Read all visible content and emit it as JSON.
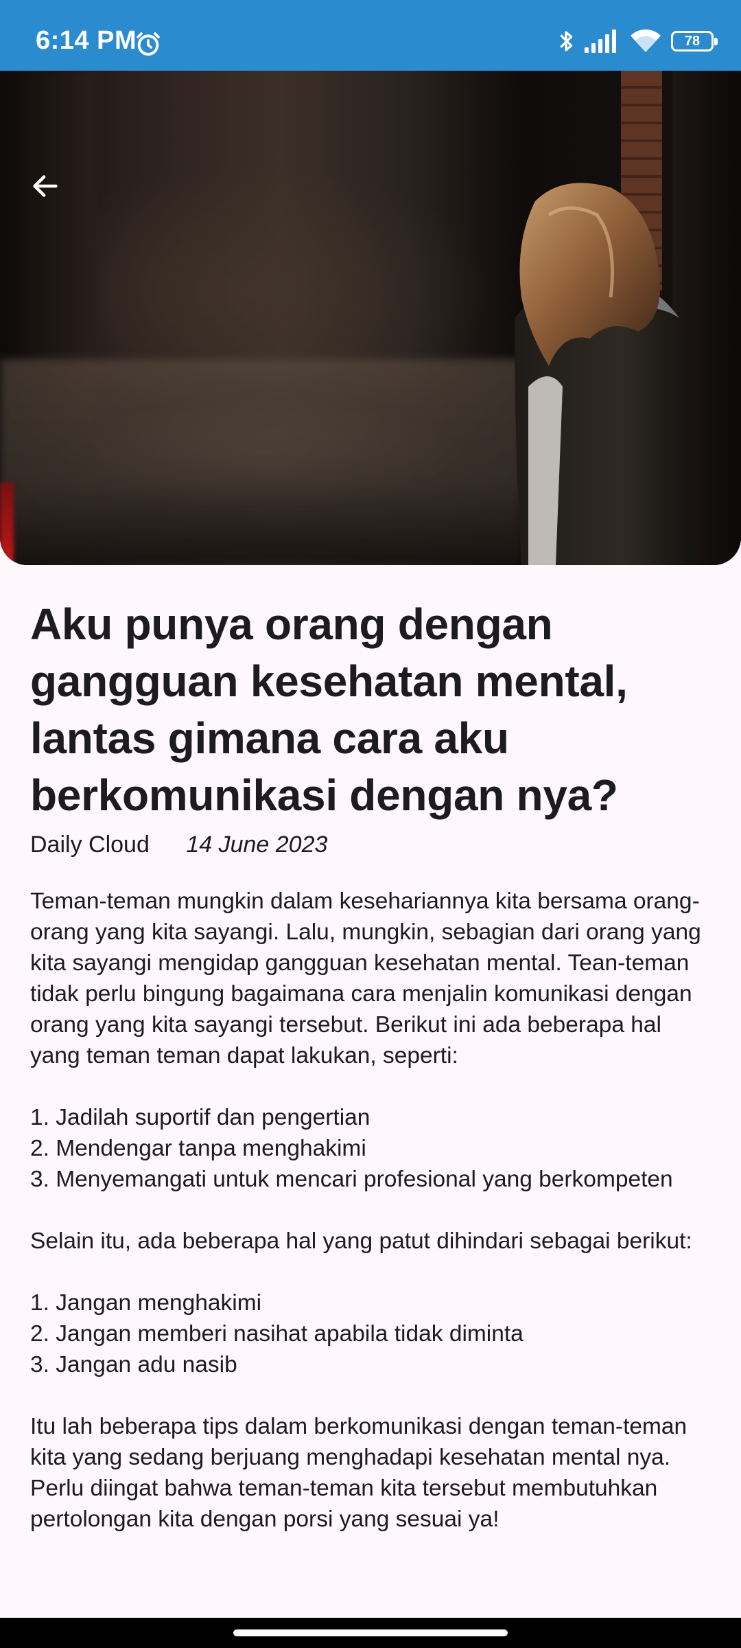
{
  "status_bar": {
    "time": "6:14 PM",
    "battery_level": "78",
    "icons": [
      "alarm-icon",
      "bluetooth-icon",
      "cellular-signal-icon",
      "wifi-icon",
      "battery-icon"
    ]
  },
  "header": {
    "back_icon": "arrow-left-icon"
  },
  "article": {
    "title": "Aku punya orang dengan gangguan kesehatan mental, lantas gimana cara aku berkomunikasi dengan nya?",
    "source": "Daily Cloud",
    "date": "14 June 2023",
    "body": "Teman-teman mungkin dalam kesehariannya kita bersama orang-orang yang kita sayangi. Lalu, mungkin, sebagian dari orang yang kita sayangi mengidap gangguan kesehatan mental. Tean-teman tidak perlu bingung bagaimana cara menjalin komunikasi dengan orang yang kita sayangi tersebut. Berikut ini ada beberapa hal yang teman teman dapat lakukan, seperti:\n\n1. Jadilah suportif dan pengertian\n2. Mendengar tanpa menghakimi\n3. Menyemangati untuk mencari profesional yang berkompeten\n\nSelain itu, ada beberapa hal yang patut dihindari sebagai berikut:\n\n1. Jangan menghakimi\n2. Jangan memberi nasihat apabila tidak diminta\n3. Jangan adu nasib\n\nItu lah beberapa tips dalam berkomunikasi dengan teman-teman kita yang sedang berjuang menghadapi kesehatan mental nya. Perlu diingat bahwa teman-teman kita tersebut membutuhkan pertolongan kita dengan porsi yang sesuai ya!"
  },
  "colors": {
    "status_bar": "#2B8BCF",
    "background": "#FEF7FC",
    "text": "#1C1B1F"
  }
}
